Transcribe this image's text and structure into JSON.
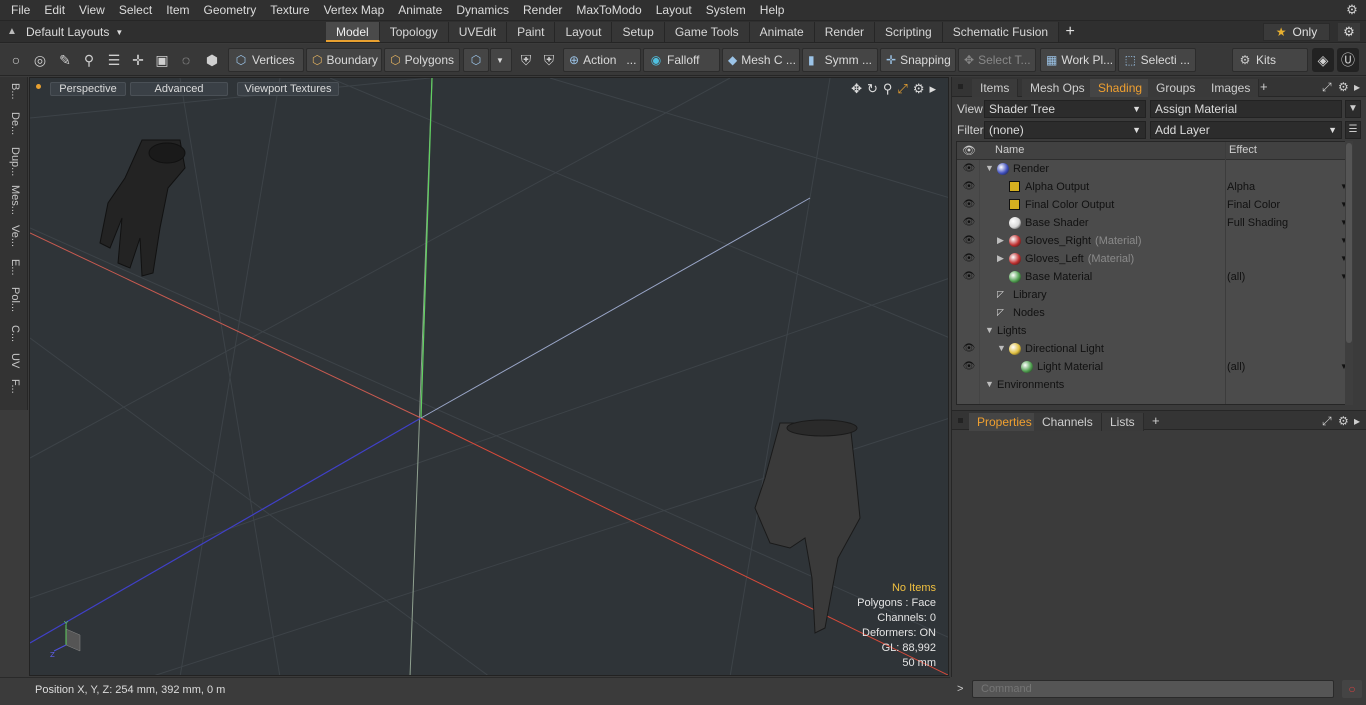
{
  "menu": [
    "File",
    "Edit",
    "View",
    "Select",
    "Item",
    "Geometry",
    "Texture",
    "Vertex Map",
    "Animate",
    "Dynamics",
    "Render",
    "MaxToModo",
    "Layout",
    "System",
    "Help"
  ],
  "layouts": {
    "label": "Default Layouts"
  },
  "mode_tabs": [
    "Model",
    "Topology",
    "UVEdit",
    "Paint",
    "Layout",
    "Setup",
    "Game Tools",
    "Animate",
    "Render",
    "Scripting",
    "Schematic Fusion"
  ],
  "active_mode_tab": "Model",
  "only_label": "Only",
  "toolbar": {
    "vertices": "Vertices",
    "boundary": "Boundary",
    "polygons": "Polygons",
    "action": "Action",
    "falloff": "Falloff",
    "mesh": "Mesh C ...",
    "symm": "Symm ...",
    "snapping": "Snapping",
    "select_t": "Select T...",
    "workpl": "Work Pl...",
    "selecti": "Selecti ...",
    "kits": "Kits"
  },
  "left_strip": [
    "B...",
    "De...",
    "Dup...",
    "Mes...",
    "Ve...",
    "E...",
    "Pol...",
    "C...",
    "UV",
    "F..."
  ],
  "viewport": {
    "perspective": "Perspective",
    "advanced": "Advanced",
    "textures": "Viewport Textures",
    "info": {
      "no_items": "No Items",
      "polygons": "Polygons : Face",
      "channels": "Channels: 0",
      "deformers": "Deformers: ON",
      "gl": "GL: 88,992",
      "size": "50 mm"
    }
  },
  "status": {
    "position": "Position X, Y, Z:  254 mm, 392 mm, 0 m"
  },
  "right_tabs": [
    "Items",
    "Mesh Ops",
    "Shading",
    "Groups",
    "Images"
  ],
  "active_right_tab": "Shading",
  "view_row": {
    "label": "View",
    "value": "Shader Tree",
    "assign": "Assign Material"
  },
  "filter_row": {
    "label": "Filter",
    "value": "(none)",
    "add": "Add Layer"
  },
  "shader_tree": {
    "col_name": "Name",
    "col_effect": "Effect",
    "rows": [
      {
        "name": "Render",
        "sub": "",
        "effect": "",
        "eye": true,
        "icon": "render"
      },
      {
        "name": "Alpha Output",
        "sub": "",
        "effect": "Alpha",
        "eye": true,
        "icon": "output"
      },
      {
        "name": "Final Color Output",
        "sub": "",
        "effect": "Final Color",
        "eye": true,
        "icon": "output"
      },
      {
        "name": "Base Shader",
        "sub": "",
        "effect": "Full Shading",
        "eye": true,
        "icon": "shader"
      },
      {
        "name": "Gloves_Right",
        "sub": "(Material)",
        "effect": "",
        "eye": true,
        "icon": "mat-red"
      },
      {
        "name": "Gloves_Left",
        "sub": "(Material)",
        "effect": "",
        "eye": true,
        "icon": "mat-red"
      },
      {
        "name": "Base Material",
        "sub": "",
        "effect": "(all)",
        "eye": true,
        "icon": "mat-green"
      },
      {
        "name": "Library",
        "sub": "",
        "effect": "",
        "eye": false,
        "icon": "folder"
      },
      {
        "name": "Nodes",
        "sub": "",
        "effect": "",
        "eye": false,
        "icon": "folder"
      },
      {
        "name": "Lights",
        "sub": "",
        "effect": "",
        "eye": false,
        "icon": "none"
      },
      {
        "name": "Directional Light",
        "sub": "",
        "effect": "",
        "eye": true,
        "icon": "light"
      },
      {
        "name": "Light Material",
        "sub": "",
        "effect": "(all)",
        "eye": true,
        "icon": "mat-green"
      },
      {
        "name": "Environments",
        "sub": "",
        "effect": "",
        "eye": false,
        "icon": "none"
      }
    ]
  },
  "prop_tabs": [
    "Properties",
    "Channels",
    "Lists"
  ],
  "active_prop_tab": "Properties",
  "command": {
    "placeholder": "Command"
  }
}
